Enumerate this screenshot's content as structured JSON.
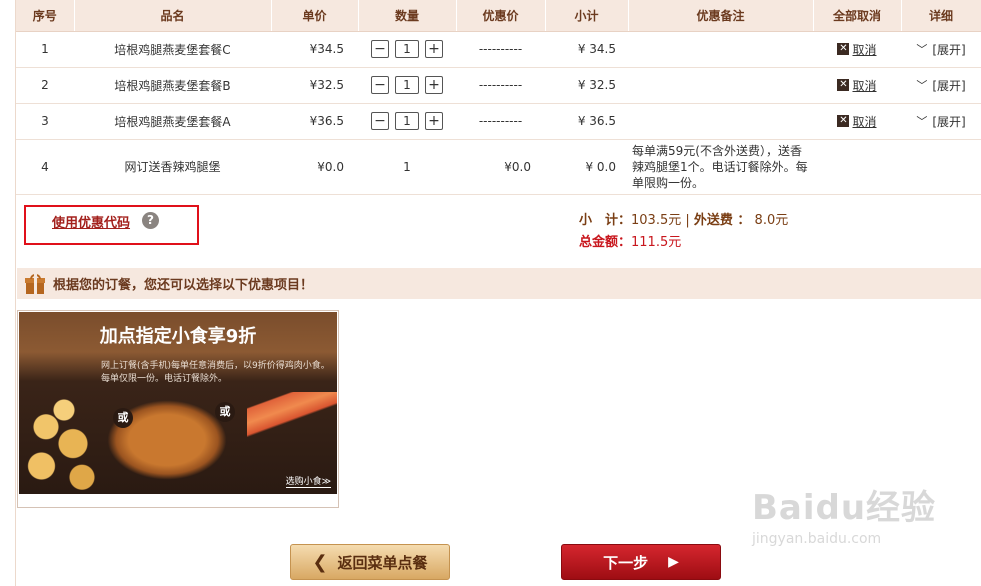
{
  "table": {
    "headers": [
      "序号",
      "品名",
      "单价",
      "数量",
      "优惠价",
      "小计",
      "优惠备注",
      "全部取消",
      "详细"
    ],
    "rows": [
      {
        "no": "1",
        "name": "培根鸡腿燕麦堡套餐C",
        "price": "¥34.5",
        "qty": "1",
        "discount": "----------",
        "subtotal": "¥ 34.5",
        "remark": "",
        "cancel": "取消",
        "detail": "[展开]"
      },
      {
        "no": "2",
        "name": "培根鸡腿燕麦堡套餐B",
        "price": "¥32.5",
        "qty": "1",
        "discount": "----------",
        "subtotal": "¥ 32.5",
        "remark": "",
        "cancel": "取消",
        "detail": "[展开]"
      },
      {
        "no": "3",
        "name": "培根鸡腿燕麦堡套餐A",
        "price": "¥36.5",
        "qty": "1",
        "discount": "----------",
        "subtotal": "¥ 36.5",
        "remark": "",
        "cancel": "取消",
        "detail": "[展开]"
      },
      {
        "no": "4",
        "name": "网订送香辣鸡腿堡",
        "price": "¥0.0",
        "qty": "1",
        "discount": "¥0.0",
        "subtotal": "¥ 0.0",
        "remark": "每单满59元(不含外送费），送香辣鸡腿堡1个。电话订餐除外。每单限购一份。"
      }
    ],
    "qty_minus": "−",
    "qty_plus": "+"
  },
  "coupon": {
    "link": "使用优惠代码",
    "help": "?"
  },
  "totals": {
    "subtotal_label": "小　计：",
    "subtotal_value": "103.5元",
    "sep": " | ",
    "delivery_label": "外送费 ：",
    "delivery_value": " 8.0元",
    "grand_label": "总金额：",
    "grand_value": "111.5元"
  },
  "promo": {
    "title": "根据您的订餐，您还可以选择以下优惠项目！",
    "headline": "加点指定小食享9折",
    "subtext": "网上订餐(含手机)每单任意消费后，以9折价得鸡肉小食。每单仅限一份。电话订餐除外。",
    "or": "或",
    "more": "选购小食≫"
  },
  "buttons": {
    "back": "返回菜单点餐",
    "back_arrow": "❮",
    "next": "下一步",
    "next_arrow": "▶"
  },
  "watermark": {
    "brand": "Baidu经验",
    "site": "jingyan.baidu.com"
  }
}
